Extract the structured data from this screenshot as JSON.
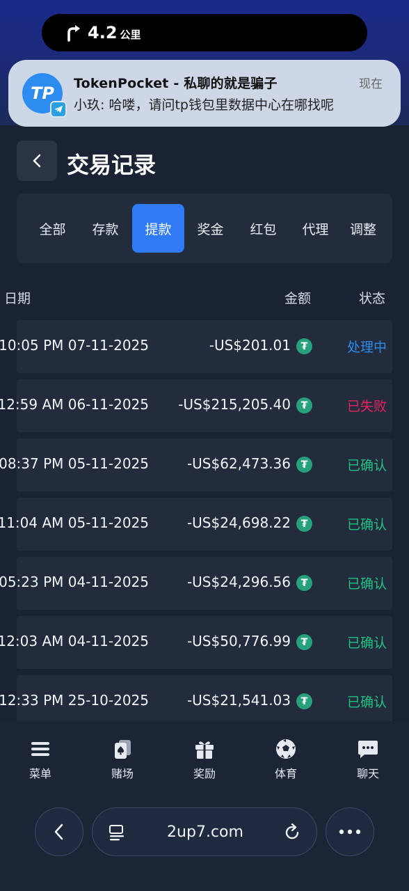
{
  "dynamic_island": {
    "distance": "4.2",
    "unit": "公里"
  },
  "notification": {
    "app_icon_text": "TP",
    "title": "TokenPocket - 私聊的就是骗子",
    "message": "小玖: 哈喽，请问tp钱包里数据中心在哪找呢",
    "time": "现在"
  },
  "header": {
    "title": "交易记录"
  },
  "tabs": [
    {
      "label": "全部",
      "active": false
    },
    {
      "label": "存款",
      "active": false
    },
    {
      "label": "提款",
      "active": true
    },
    {
      "label": "奖金",
      "active": false
    },
    {
      "label": "红包",
      "active": false
    },
    {
      "label": "代理",
      "active": false
    },
    {
      "label": "调整",
      "active": false
    }
  ],
  "table": {
    "headers": {
      "date": "日期",
      "amount": "金额",
      "status": "状态"
    },
    "rows": [
      {
        "date": "10:05 PM 07-11-2025",
        "amount": "-US$201.01",
        "status": "处理中",
        "status_color": "#2d8cf0"
      },
      {
        "date": "12:59 AM 06-11-2025",
        "amount": "-US$215,205.40",
        "status": "已失败",
        "status_color": "#e8245c"
      },
      {
        "date": "08:37 PM 05-11-2025",
        "amount": "-US$62,473.36",
        "status": "已确认",
        "status_color": "#1fc281"
      },
      {
        "date": "11:04 AM 05-11-2025",
        "amount": "-US$24,698.22",
        "status": "已确认",
        "status_color": "#1fc281"
      },
      {
        "date": "05:23 PM 04-11-2025",
        "amount": "-US$24,296.56",
        "status": "已确认",
        "status_color": "#1fc281"
      },
      {
        "date": "12:03 AM 04-11-2025",
        "amount": "-US$50,776.99",
        "status": "已确认",
        "status_color": "#1fc281"
      },
      {
        "date": "12:33 PM 25-10-2025",
        "amount": "-US$21,541.03",
        "status": "已确认",
        "status_color": "#1fc281"
      }
    ],
    "coin_icon": "tether-usdt-icon",
    "coin_symbol": "₮"
  },
  "bottom_nav": [
    {
      "label": "菜单",
      "icon": "menu-icon"
    },
    {
      "label": "赌场",
      "icon": "cards-icon"
    },
    {
      "label": "奖励",
      "icon": "gift-icon"
    },
    {
      "label": "体育",
      "icon": "soccer-ball-icon"
    },
    {
      "label": "聊天",
      "icon": "chat-icon"
    }
  ],
  "browser": {
    "url": "2up7.com"
  },
  "colors": {
    "background": "#1a2333",
    "card": "#222c3c",
    "accent": "#2f7bf5",
    "usdt": "#27a17c"
  }
}
